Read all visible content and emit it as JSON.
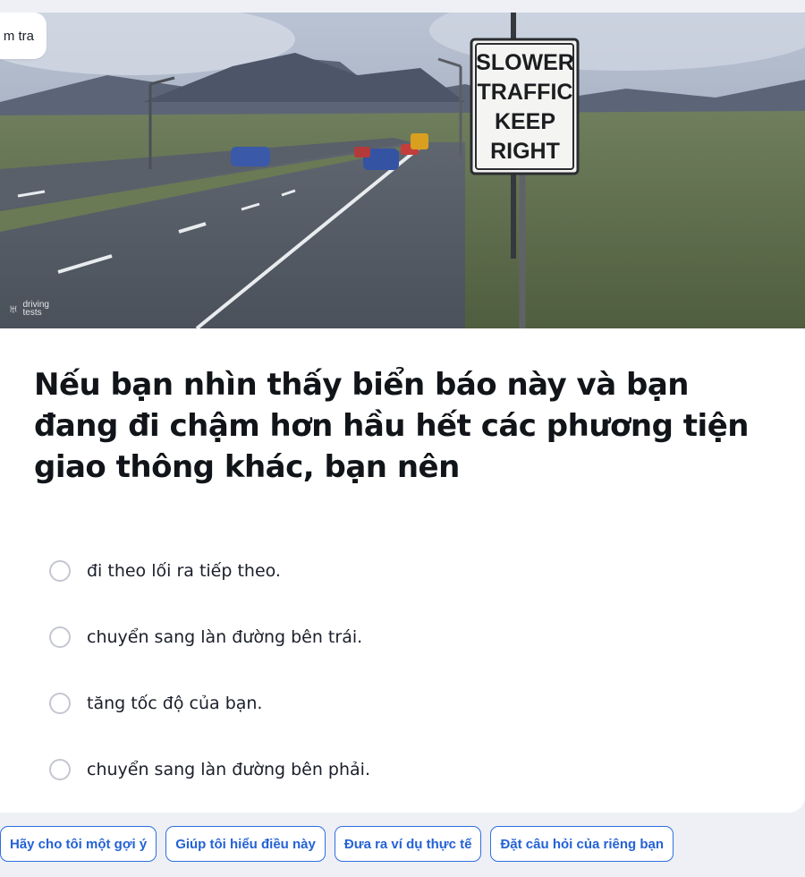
{
  "header": {
    "tab_label": "m tra"
  },
  "image": {
    "sign_lines": [
      "SLOWER",
      "TRAFFIC",
      "KEEP",
      "RIGHT"
    ],
    "watermark_line1": "driving",
    "watermark_line2": "tests"
  },
  "question": {
    "text": "Nếu bạn nhìn thấy biển báo này và bạn đang đi chậm hơn hầu hết các phương tiện giao thông khác, bạn nên"
  },
  "options": [
    {
      "label": "đi theo lối ra tiếp theo."
    },
    {
      "label": "chuyển sang làn đường bên trái."
    },
    {
      "label": "tăng tốc độ của bạn."
    },
    {
      "label": "chuyển sang làn đường bên phải."
    }
  ],
  "suggestions": [
    {
      "label": "Hãy cho tôi một gợi ý"
    },
    {
      "label": "Giúp tôi hiểu điều này"
    },
    {
      "label": "Đưa ra ví dụ thực tế"
    },
    {
      "label": "Đặt câu hỏi của riêng bạn"
    }
  ]
}
